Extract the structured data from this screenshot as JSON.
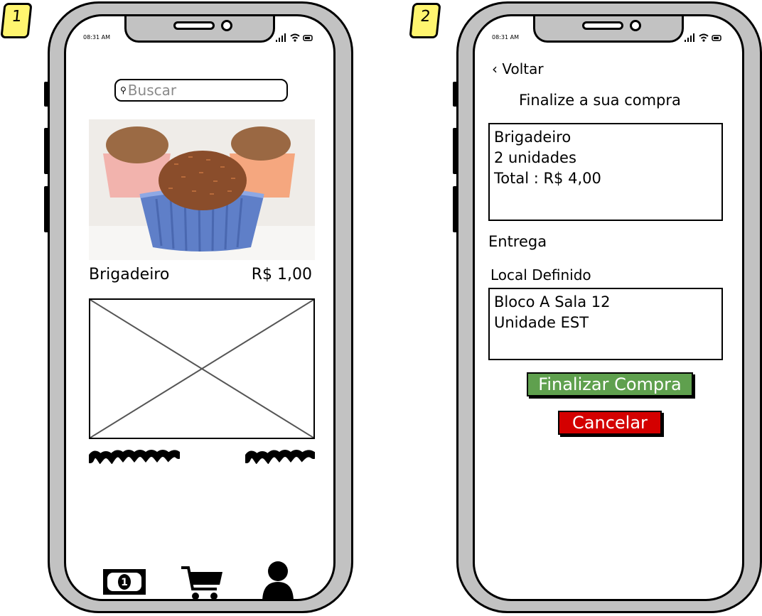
{
  "badges": [
    "1",
    "2"
  ],
  "status": {
    "time": "08:31 AM",
    "icons": [
      "signal-icon",
      "wifi-icon",
      "battery-icon"
    ]
  },
  "screen1": {
    "search_placeholder": "Buscar",
    "product": {
      "name": "Brigadeiro",
      "price": "R$ 1,00"
    },
    "nav": [
      "money-icon",
      "cart-icon",
      "user-icon"
    ]
  },
  "screen2": {
    "back_label": "‹ Voltar",
    "title": "Finalize a sua compra",
    "summary": {
      "line1": "Brigadeiro",
      "line2": "2 unidades",
      "line3": "Total : R$ 4,00"
    },
    "delivery_label": "Entrega",
    "location_label": "Local Definido",
    "address": {
      "line1": "Bloco A Sala 12",
      "line2": "Unidade EST"
    },
    "finalize_label": "Finalizar Compra",
    "cancel_label": "Cancelar"
  },
  "colors": {
    "badge": "#fff56f",
    "phone_body": "#c2c2c2",
    "finalize": "#5fa04e",
    "cancel": "#d40000"
  }
}
